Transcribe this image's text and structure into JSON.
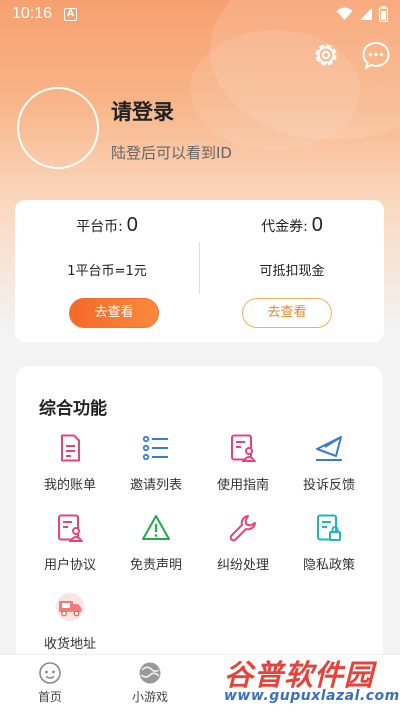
{
  "status_bar": {
    "time": "10:16",
    "notification_badge": "A"
  },
  "profile": {
    "title": "请登录",
    "subtitle": "陆登后可以看到ID"
  },
  "wallet": {
    "platform_coin": {
      "label": "平台币:",
      "value": "0",
      "desc": "1平台币=1元",
      "button": "去查看"
    },
    "voucher": {
      "label": "代金券:",
      "value": "0",
      "desc": "可抵扣现金",
      "button": "去查看"
    }
  },
  "features": {
    "title": "综合功能",
    "items": [
      {
        "label": "我的账单",
        "icon": "bill-icon"
      },
      {
        "label": "邀请列表",
        "icon": "list-icon"
      },
      {
        "label": "使用指南",
        "icon": "guide-icon"
      },
      {
        "label": "投诉反馈",
        "icon": "feedback-icon"
      },
      {
        "label": "用户协议",
        "icon": "agreement-icon"
      },
      {
        "label": "免责声明",
        "icon": "warning-icon"
      },
      {
        "label": "纠纷处理",
        "icon": "wrench-icon"
      },
      {
        "label": "隐私政策",
        "icon": "privacy-icon"
      },
      {
        "label": "收货地址",
        "icon": "delivery-truck-icon"
      }
    ]
  },
  "bottom_nav": [
    {
      "label": "首页",
      "icon": "home-icon"
    },
    {
      "label": "小游戏",
      "icon": "game-icon"
    }
  ],
  "watermark": {
    "brand": "谷普软件园",
    "url": "www.gupuxlazal.com"
  },
  "colors": {
    "accent_orange": "#f5682a",
    "outline_orange": "#ecb15f",
    "icon_pink": "#e8447a",
    "icon_blue": "#3b7bd8",
    "icon_green": "#27a84a",
    "icon_teal": "#1fb6c4"
  }
}
